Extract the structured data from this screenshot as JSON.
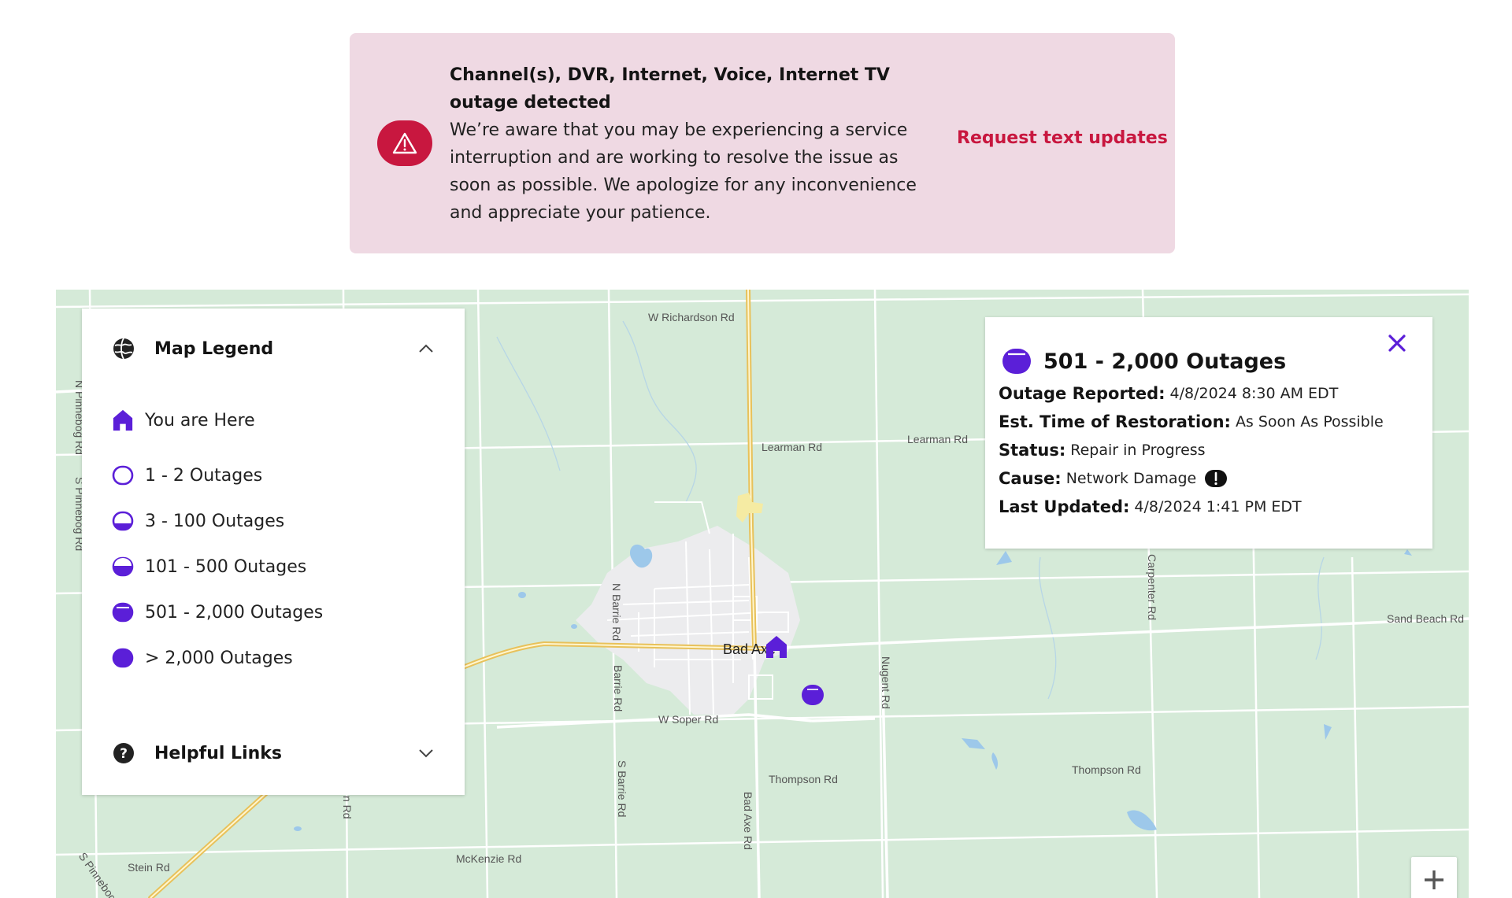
{
  "alert": {
    "title": "Channel(s), DVR, Internet, Voice, Internet TV outage detected",
    "body": "We’re aware that you may be experiencing a service interruption and are working to resolve the issue as soon as possible. We apologize for any inconvenience and appreciate your patience.",
    "link_label": "Request text updates",
    "icon": "warning-triangle-icon"
  },
  "legend": {
    "title": "Map Legend",
    "items": [
      {
        "label": "You are Here",
        "icon": "home-icon"
      },
      {
        "label": "1 - 2 Outages",
        "icon": "outage-level-1-icon"
      },
      {
        "label": "3 - 100 Outages",
        "icon": "outage-level-2-icon"
      },
      {
        "label": "101 - 500 Outages",
        "icon": "outage-level-3-icon"
      },
      {
        "label": "501 - 2,000 Outages",
        "icon": "outage-level-4-icon"
      },
      {
        "label": "> 2,000 Outages",
        "icon": "outage-level-5-icon"
      }
    ],
    "helpful_links_title": "Helpful Links"
  },
  "popup": {
    "title": "501 - 2,000 Outages",
    "rows": [
      {
        "key": "Outage Reported:",
        "value": "4/8/2024 8:30 AM EDT"
      },
      {
        "key": "Est. Time of Restoration:",
        "value": "As Soon As Possible"
      },
      {
        "key": "Status:",
        "value": "Repair in Progress"
      },
      {
        "key": "Cause:",
        "value": "Network Damage"
      },
      {
        "key": "Last Updated:",
        "value": "4/8/2024 1:41 PM EDT"
      }
    ]
  },
  "map": {
    "town": "Bad Axe",
    "roads": {
      "w_richardson": "W Richardson Rd",
      "learman_1": "Learman Rd",
      "learman_2": "Learman Rd",
      "sand_beach": "Sand Beach Rd",
      "w_soper": "W Soper Rd",
      "thompson_1": "Thompson Rd",
      "thompson_2": "Thompson Rd",
      "mckenzie": "McKenzie Rd",
      "stein": "Stein Rd",
      "n_barrie": "N Barrie Rd",
      "barrie": "Barrie Rd",
      "s_barrie": "S Barrie Rd",
      "bad_axe_rd": "Bad Axe Rd",
      "nugent": "Nugent Rd",
      "carpenter": "Carpenter Rd",
      "n_pinnebog": "N Pinnebog Rd",
      "s_pinnebog": "S Pinnebog Rd",
      "s_pinnebog_2": "S Pinnebog R",
      "n_rd": "n Rd"
    },
    "zoom_in_label": "+"
  },
  "colors": {
    "brand_red": "#c8173f",
    "outage_purple": "#5b1fd8",
    "map_green": "#d5ead8",
    "alert_bg": "#efd9e3"
  }
}
